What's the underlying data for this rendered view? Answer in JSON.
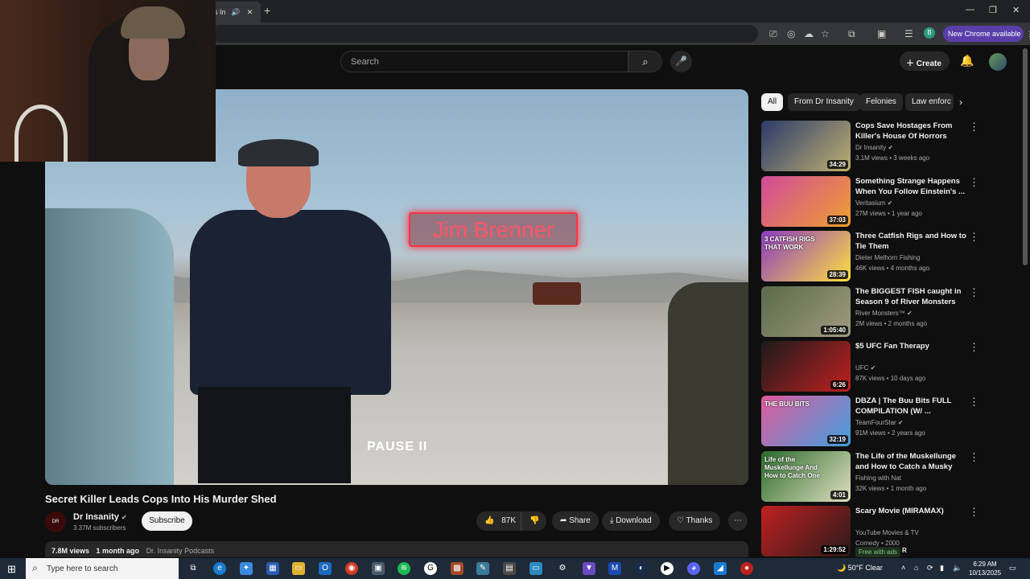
{
  "browser": {
    "tab_title": "s In",
    "new_chrome_label": "New Chrome available",
    "profile_initial": "B"
  },
  "header": {
    "search_placeholder": "Search",
    "create_label": "Create"
  },
  "video": {
    "name_overlay": "Jim Brenner",
    "pause_label": "PAUSE II",
    "title": "Secret Killer Leads Cops Into His Murder Shed",
    "channel": "Dr Insanity",
    "subscribers": "3.37M subscribers",
    "subscribe_label": "Subscribe",
    "likes": "87K",
    "share_label": "Share",
    "download_label": "Download",
    "thanks_label": "Thanks",
    "views": "7.8M views",
    "age": "1 month ago",
    "tag": "Dr. Insanity Podcasts",
    "avatar_text": "DR"
  },
  "chips": [
    "All",
    "From Dr Insanity",
    "Felonies",
    "Law enforc"
  ],
  "recommendations": [
    {
      "title": "Cops Save Hostages From Killer's House Of Horrors",
      "channel": "Dr Insanity",
      "verified": true,
      "meta": "3.1M views • 3 weeks ago",
      "duration": "34:29",
      "color1": "#2a3a6a",
      "color2": "#c0b070"
    },
    {
      "title": "Something Strange Happens When You Follow Einstein's ...",
      "channel": "Veritasium",
      "verified": true,
      "meta": "27M views • 1 year ago",
      "duration": "37:03",
      "color1": "#d04a9a",
      "color2": "#f0a030"
    },
    {
      "title": "Three Catfish Rigs and How to Tie Them",
      "channel": "Dieter Melhorn Fishing",
      "verified": false,
      "meta": "46K views • 4 months ago",
      "duration": "28:39",
      "color1": "#8a3ac0",
      "color2": "#ffe040",
      "thumb_text": "3 CATFISH RIGS THAT WORK"
    },
    {
      "title": "The BIGGEST FISH caught in Season 9 of River Monsters",
      "channel": "River Monsters™",
      "verified": true,
      "meta": "2M views • 2 months ago",
      "duration": "1:05:40",
      "color1": "#5a6a4a",
      "color2": "#a09a80"
    },
    {
      "title": "$5 UFC Fan Therapy",
      "channel": "UFC",
      "verified": true,
      "meta": "87K views • 10 days ago",
      "duration": "6:26",
      "color1": "#1a1a1a",
      "color2": "#c02020"
    },
    {
      "title": "DBZA | The Buu Bits FULL COMPILATION (W/ ...",
      "channel": "TeamFourStar",
      "verified": true,
      "meta": "91M views • 2 years ago",
      "duration": "32:19",
      "color1": "#e05a9a",
      "color2": "#40a0e0",
      "thumb_text": "THE BUU BITS"
    },
    {
      "title": "The Life of the Muskellunge and How to Catch a Musky",
      "channel": "Fishing with Nat",
      "verified": false,
      "meta": "32K views • 1 month ago",
      "duration": "4:01",
      "color1": "#2a6a2a",
      "color2": "#e0e0c0",
      "thumb_text": "Life of the Muskellunge And How to Catch One"
    },
    {
      "title": "Scary Movie (MIRAMAX)",
      "channel": "YouTube Movies & TV",
      "verified": false,
      "meta": "Comedy • 2000",
      "duration": "1:29:52",
      "color1": "#c02020",
      "color2": "#2a1a1a",
      "free": "Free with ads",
      "rating": "R"
    }
  ],
  "taskbar": {
    "search_placeholder": "Type here to search",
    "weather": "50°F  Clear",
    "time": "6:29 AM",
    "date": "10/13/2025"
  }
}
